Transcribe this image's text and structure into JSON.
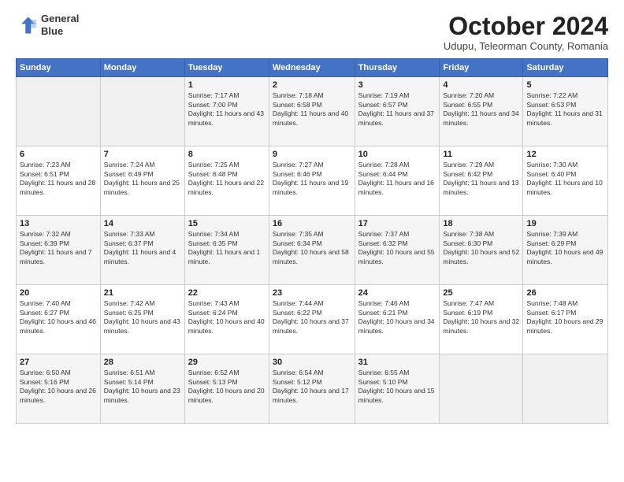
{
  "header": {
    "logo_line1": "General",
    "logo_line2": "Blue",
    "title": "October 2024",
    "location": "Udupu, Teleorman County, Romania"
  },
  "weekdays": [
    "Sunday",
    "Monday",
    "Tuesday",
    "Wednesday",
    "Thursday",
    "Friday",
    "Saturday"
  ],
  "weeks": [
    [
      {
        "day": "",
        "info": ""
      },
      {
        "day": "",
        "info": ""
      },
      {
        "day": "1",
        "info": "Sunrise: 7:17 AM\nSunset: 7:00 PM\nDaylight: 11 hours and 43 minutes."
      },
      {
        "day": "2",
        "info": "Sunrise: 7:18 AM\nSunset: 6:58 PM\nDaylight: 11 hours and 40 minutes."
      },
      {
        "day": "3",
        "info": "Sunrise: 7:19 AM\nSunset: 6:57 PM\nDaylight: 11 hours and 37 minutes."
      },
      {
        "day": "4",
        "info": "Sunrise: 7:20 AM\nSunset: 6:55 PM\nDaylight: 11 hours and 34 minutes."
      },
      {
        "day": "5",
        "info": "Sunrise: 7:22 AM\nSunset: 6:53 PM\nDaylight: 11 hours and 31 minutes."
      }
    ],
    [
      {
        "day": "6",
        "info": "Sunrise: 7:23 AM\nSunset: 6:51 PM\nDaylight: 11 hours and 28 minutes."
      },
      {
        "day": "7",
        "info": "Sunrise: 7:24 AM\nSunset: 6:49 PM\nDaylight: 11 hours and 25 minutes."
      },
      {
        "day": "8",
        "info": "Sunrise: 7:25 AM\nSunset: 6:48 PM\nDaylight: 11 hours and 22 minutes."
      },
      {
        "day": "9",
        "info": "Sunrise: 7:27 AM\nSunset: 6:46 PM\nDaylight: 11 hours and 19 minutes."
      },
      {
        "day": "10",
        "info": "Sunrise: 7:28 AM\nSunset: 6:44 PM\nDaylight: 11 hours and 16 minutes."
      },
      {
        "day": "11",
        "info": "Sunrise: 7:29 AM\nSunset: 6:42 PM\nDaylight: 11 hours and 13 minutes."
      },
      {
        "day": "12",
        "info": "Sunrise: 7:30 AM\nSunset: 6:40 PM\nDaylight: 11 hours and 10 minutes."
      }
    ],
    [
      {
        "day": "13",
        "info": "Sunrise: 7:32 AM\nSunset: 6:39 PM\nDaylight: 11 hours and 7 minutes."
      },
      {
        "day": "14",
        "info": "Sunrise: 7:33 AM\nSunset: 6:37 PM\nDaylight: 11 hours and 4 minutes."
      },
      {
        "day": "15",
        "info": "Sunrise: 7:34 AM\nSunset: 6:35 PM\nDaylight: 11 hours and 1 minute."
      },
      {
        "day": "16",
        "info": "Sunrise: 7:35 AM\nSunset: 6:34 PM\nDaylight: 10 hours and 58 minutes."
      },
      {
        "day": "17",
        "info": "Sunrise: 7:37 AM\nSunset: 6:32 PM\nDaylight: 10 hours and 55 minutes."
      },
      {
        "day": "18",
        "info": "Sunrise: 7:38 AM\nSunset: 6:30 PM\nDaylight: 10 hours and 52 minutes."
      },
      {
        "day": "19",
        "info": "Sunrise: 7:39 AM\nSunset: 6:29 PM\nDaylight: 10 hours and 49 minutes."
      }
    ],
    [
      {
        "day": "20",
        "info": "Sunrise: 7:40 AM\nSunset: 6:27 PM\nDaylight: 10 hours and 46 minutes."
      },
      {
        "day": "21",
        "info": "Sunrise: 7:42 AM\nSunset: 6:25 PM\nDaylight: 10 hours and 43 minutes."
      },
      {
        "day": "22",
        "info": "Sunrise: 7:43 AM\nSunset: 6:24 PM\nDaylight: 10 hours and 40 minutes."
      },
      {
        "day": "23",
        "info": "Sunrise: 7:44 AM\nSunset: 6:22 PM\nDaylight: 10 hours and 37 minutes."
      },
      {
        "day": "24",
        "info": "Sunrise: 7:46 AM\nSunset: 6:21 PM\nDaylight: 10 hours and 34 minutes."
      },
      {
        "day": "25",
        "info": "Sunrise: 7:47 AM\nSunset: 6:19 PM\nDaylight: 10 hours and 32 minutes."
      },
      {
        "day": "26",
        "info": "Sunrise: 7:48 AM\nSunset: 6:17 PM\nDaylight: 10 hours and 29 minutes."
      }
    ],
    [
      {
        "day": "27",
        "info": "Sunrise: 6:50 AM\nSunset: 5:16 PM\nDaylight: 10 hours and 26 minutes."
      },
      {
        "day": "28",
        "info": "Sunrise: 6:51 AM\nSunset: 5:14 PM\nDaylight: 10 hours and 23 minutes."
      },
      {
        "day": "29",
        "info": "Sunrise: 6:52 AM\nSunset: 5:13 PM\nDaylight: 10 hours and 20 minutes."
      },
      {
        "day": "30",
        "info": "Sunrise: 6:54 AM\nSunset: 5:12 PM\nDaylight: 10 hours and 17 minutes."
      },
      {
        "day": "31",
        "info": "Sunrise: 6:55 AM\nSunset: 5:10 PM\nDaylight: 10 hours and 15 minutes."
      },
      {
        "day": "",
        "info": ""
      },
      {
        "day": "",
        "info": ""
      }
    ]
  ]
}
